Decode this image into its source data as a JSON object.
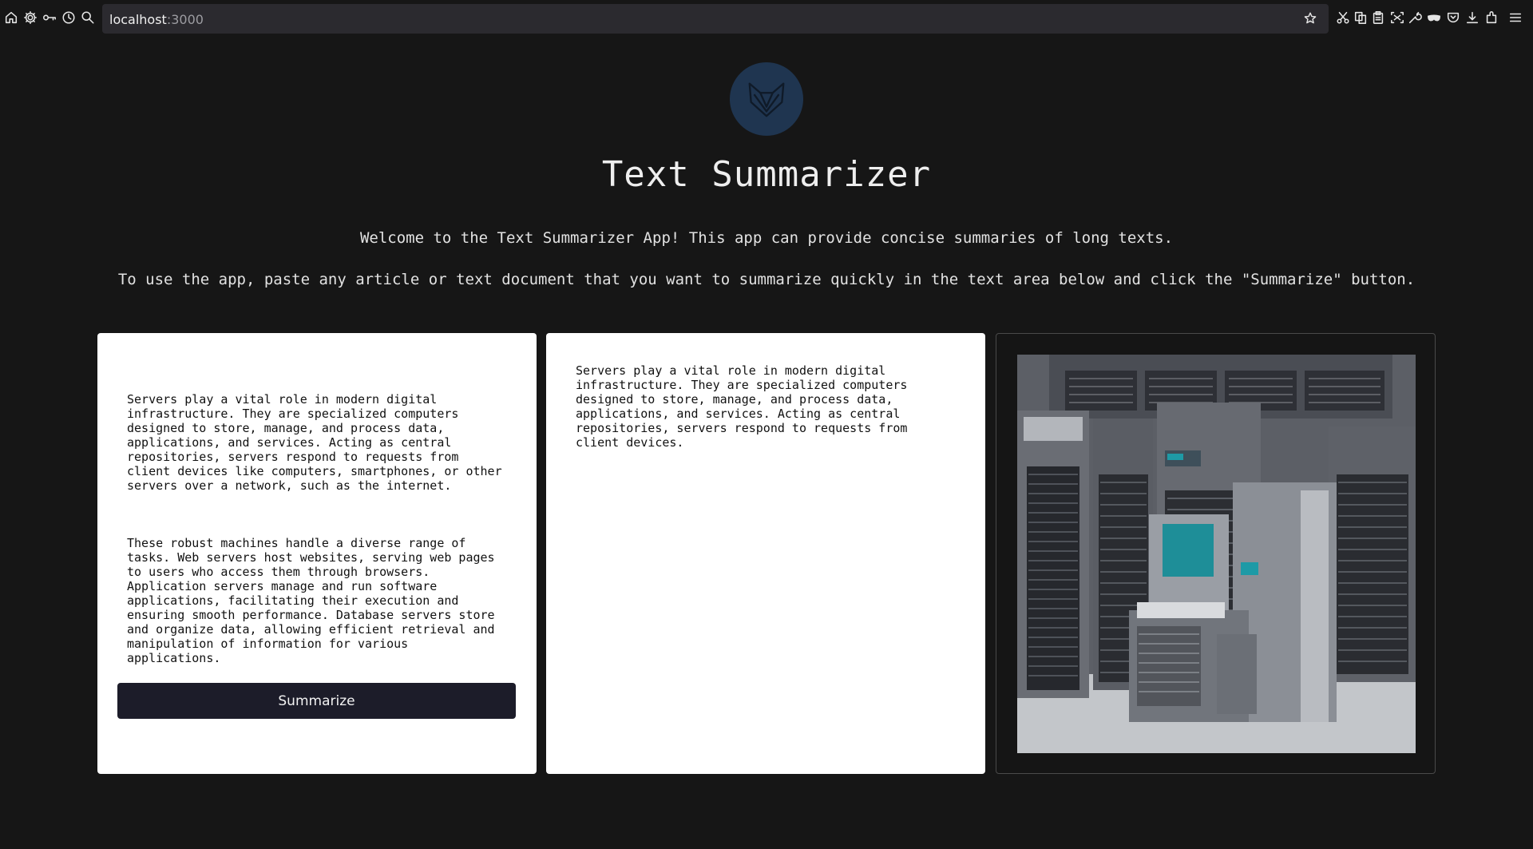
{
  "browser": {
    "url_host": "localhost",
    "url_port": ":3000"
  },
  "app": {
    "title": "Text Summarizer",
    "intro_line_1": "Welcome to the Text Summarizer App! This app can provide concise summaries of long texts.",
    "intro_line_2": "To use the app, paste any article or text document that you want to summarize quickly in the text area below and click the \"Summarize\" button."
  },
  "input_panel": {
    "paragraph_1": "Servers play a vital role in modern digital\ninfrastructure. They are specialized computers\ndesigned to store, manage, and process data,\napplications, and services. Acting as central\nrepositories, servers respond to requests from\nclient devices like computers, smartphones, or other\nservers over a network, such as the internet.",
    "paragraph_2": "These robust machines handle a diverse range of\ntasks. Web servers host websites, serving web pages\nto users who access them through browsers.\nApplication servers manage and run software\napplications, facilitating their execution and\nensuring smooth performance. Database servers store\nand organize data, allowing efficient retrieval and\nmanipulation of information for various\napplications.",
    "summarize_label": "Summarize"
  },
  "output_panel": {
    "summary": "Servers play a vital role in modern digital\ninfrastructure. They are specialized computers\ndesigned to store, manage, and process data,\napplications, and services. Acting as central\nrepositories, servers respond to requests from\nclient devices."
  },
  "image_panel": {
    "illustration": "server-room-illustration"
  },
  "icons": {
    "toolbar_left": [
      "home-icon",
      "gear-icon",
      "key-icon",
      "history-icon",
      "search-icon"
    ],
    "toolbar_right": [
      "scissors-icon",
      "copy-icon",
      "clipboard-icon",
      "screenshot-icon",
      "wrench-icon",
      "mask-icon",
      "pocket-icon",
      "download-icon",
      "extensions-icon",
      "menu-icon"
    ],
    "logo": "fox-logo-icon"
  },
  "colors": {
    "background": "#161616",
    "logo_circle": "#1f3550",
    "button": "#1c1c29"
  }
}
